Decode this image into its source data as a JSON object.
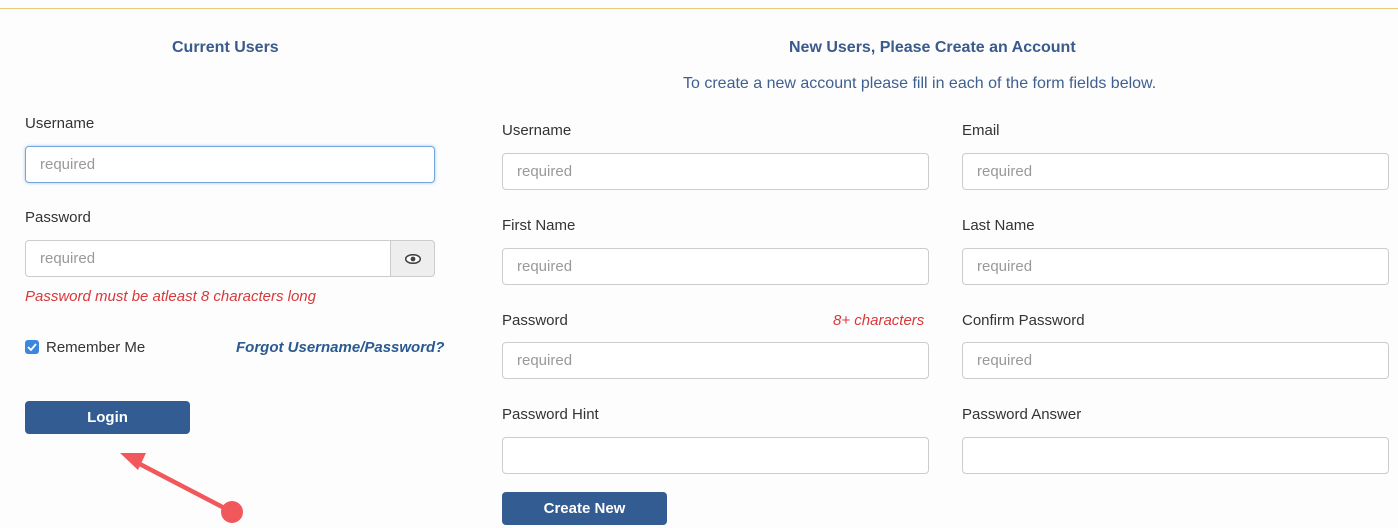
{
  "login": {
    "heading": "Current Users",
    "username_label": "Username",
    "username_placeholder": "required",
    "password_label": "Password",
    "password_placeholder": "required",
    "password_error": "Password must be atleast 8 characters long",
    "remember_label": "Remember Me",
    "remember_checked": true,
    "forgot_link": "Forgot Username/Password?",
    "login_button": "Login"
  },
  "register": {
    "heading": "New Users, Please Create an Account",
    "subtitle": "To create a new account please fill in each of the form fields below.",
    "username_label": "Username",
    "email_label": "Email",
    "first_name_label": "First Name",
    "last_name_label": "Last Name",
    "password_label": "Password",
    "password_hint_note": "8+ characters",
    "confirm_password_label": "Confirm Password",
    "password_hint_label": "Password Hint",
    "password_answer_label": "Password Answer",
    "placeholder": "required",
    "create_button": "Create New"
  },
  "colors": {
    "accent": "#335c93",
    "heading": "#3a5a8c",
    "error": "#d9383a",
    "annotation": "#f0585c"
  }
}
